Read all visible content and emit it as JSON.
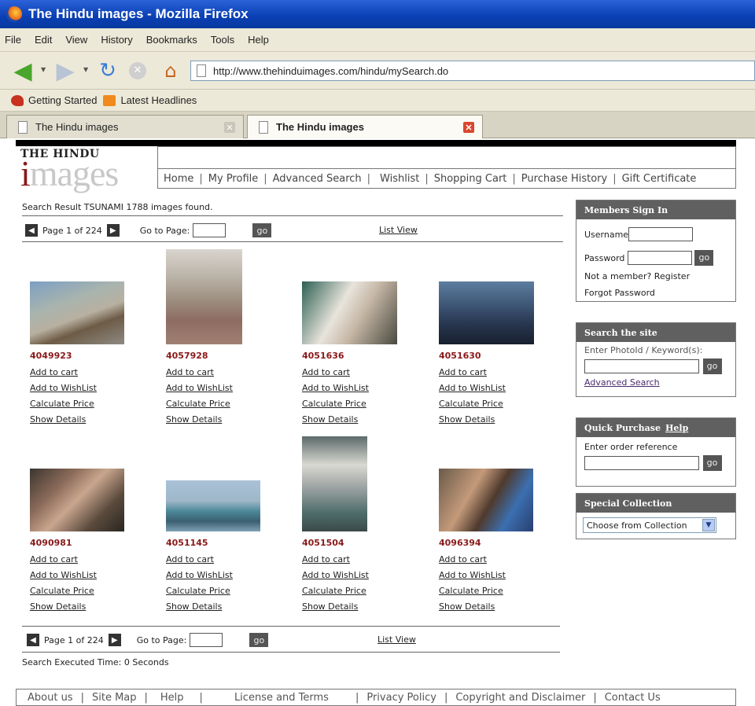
{
  "browser": {
    "window_title": "The Hindu images - Mozilla Firefox",
    "menu": [
      "File",
      "Edit",
      "View",
      "History",
      "Bookmarks",
      "Tools",
      "Help"
    ],
    "url": "http://www.thehinduimages.com/hindu/mySearch.do",
    "bookmarks": [
      "Getting Started",
      "Latest Headlines"
    ],
    "tabs": [
      {
        "label": "The Hindu images",
        "active": false
      },
      {
        "label": "The Hindu images",
        "active": true
      }
    ]
  },
  "site": {
    "logo_top": "THE HINDU",
    "logo_word": "images",
    "nav": [
      "Home",
      "My Profile",
      "Advanced Search",
      "Wishlist",
      "Shopping Cart",
      "Purchase History",
      "Gift Certificate"
    ]
  },
  "search": {
    "result_text": "Search Result  TSUNAMI  1788 images found.",
    "page_text": "Page 1 of 224",
    "goto_label": "Go to Page:",
    "go_label": "go",
    "list_view": "List View",
    "executed": "Search Executed Time:  0  Seconds"
  },
  "item_links": {
    "add_cart": "Add to cart",
    "add_wishlist": "Add to WishList",
    "calc_price": "Calculate Price",
    "show_details": "Show Details"
  },
  "images": [
    {
      "id": "4049923"
    },
    {
      "id": "4057928"
    },
    {
      "id": "4051636"
    },
    {
      "id": "4051630"
    },
    {
      "id": "4090981"
    },
    {
      "id": "4051145"
    },
    {
      "id": "4051504"
    },
    {
      "id": "4096394"
    }
  ],
  "sidebar": {
    "members": {
      "title": "Members Sign In",
      "username": "Username",
      "password": "Password",
      "go": "go",
      "not_member": "Not a member? Register",
      "forgot": "Forgot Password"
    },
    "search_site": {
      "title": "Search the site",
      "label": "Enter PhotoId / Keyword(s):",
      "go": "go",
      "advanced": "Advanced Search"
    },
    "quick": {
      "title": "Quick Purchase",
      "help": "Help",
      "label": "Enter order reference",
      "go": "go"
    },
    "special": {
      "title": "Special Collection",
      "select": "Choose from Collection"
    }
  },
  "footer": [
    "About us",
    "Site Map",
    "Help",
    "License and Terms",
    "Privacy Policy",
    "Copyright and Disclaimer",
    "Contact Us"
  ]
}
